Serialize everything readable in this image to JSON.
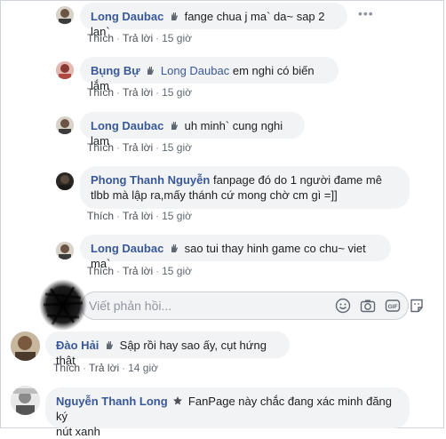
{
  "comments": [
    {
      "author": "Long Daubac",
      "text": "fange chua j ma` da~ sap 2 lan`",
      "like": "Thích",
      "reply": "Trả lời",
      "time": "15 giờ"
    },
    {
      "author": "Bụng Bự",
      "tag": "Long Daubac",
      "text": "em nghi có biến lắm",
      "like": "Thích",
      "reply": "Trả lời",
      "time": "15 giờ"
    },
    {
      "author": "Long Daubac",
      "text": "uh minh` cung nghi lam",
      "like": "Thích",
      "reply": "Trả lời",
      "time": "15 giờ"
    },
    {
      "author": "Phong Thanh Nguyễn",
      "text_line1": "fanpage đó do 1 người đame mê",
      "text_line2": "tlbb mà lập ra,mấy thánh cứ mong chờ cm gì =]]",
      "like": "Thích",
      "reply": "Trả lời",
      "time": "15 giờ"
    },
    {
      "author": "Long Daubac",
      "text": "sao tui thay hinh game co chu~ viet ma`",
      "like": "Thích",
      "reply": "Trả lời",
      "time": "15 giờ"
    },
    {
      "author": "Đào Hải",
      "text": "Sập rồi hay sao ấy, cụt hứng thật",
      "like": "Thích",
      "reply": "Trả lời",
      "time": "14 giờ"
    },
    {
      "author": "Nguyễn Thanh Long",
      "text_line1": "FanPage này chắc đang xác minh đăng ký",
      "text_line2": "nút xanh"
    }
  ],
  "reply_box": {
    "placeholder": "Viết phản hồi..."
  },
  "icons": {
    "more": "more-options-icon",
    "badge": "wave-badge-icon",
    "emoji": "emoji-icon",
    "camera": "camera-icon",
    "gif": "gif-icon",
    "sticker": "sticker-icon",
    "gif_label": "GIF"
  },
  "colors": {
    "author": "#385898",
    "bubble": "#f2f3f5",
    "meta": "#606770"
  }
}
